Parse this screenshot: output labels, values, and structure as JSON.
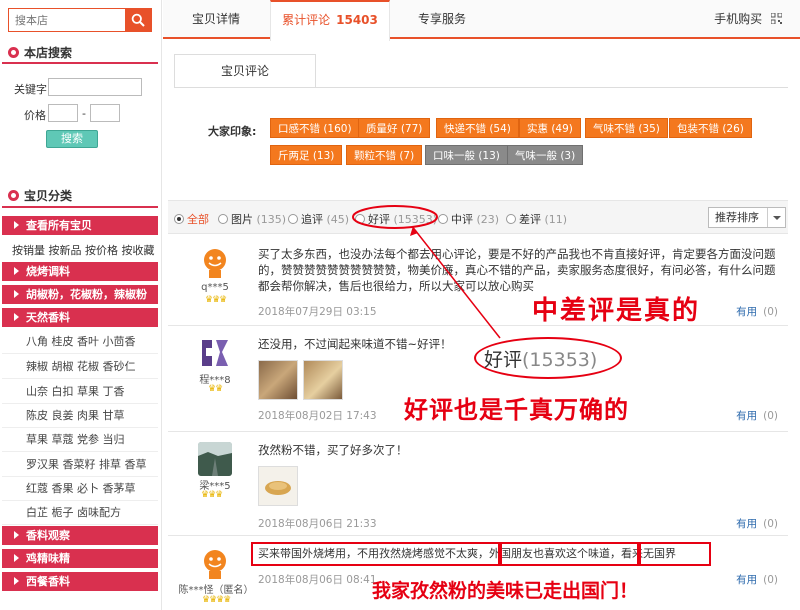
{
  "sidebar": {
    "search_placeholder": "搜本店",
    "store_search": {
      "title": "本店搜索",
      "keyword_label": "关键字",
      "price_label": "价格",
      "price_sep": "-",
      "search_button": "搜索"
    },
    "categories": {
      "title": "宝贝分类",
      "view_all": "查看所有宝贝",
      "sort_links": [
        "按销量",
        "按新品",
        "按价格",
        "按收藏"
      ],
      "bbq": "烧烤调料",
      "pepper": "胡椒粉，花椒粉，辣椒粉",
      "natural": "天然香料",
      "spice_rows": [
        "八角 桂皮 香叶 小茴香",
        "辣椒 胡椒 花椒 香砂仁",
        "山奈 白扣 草果 丁香",
        "陈皮 良姜 肉果 甘草",
        "草果 草蔻 党参 当归",
        "罗汉果 香菜籽 排草 香草",
        "红蔻 香果 必卜 香茅草",
        "白芷 栀子 卤味配方"
      ],
      "spice_cover": "香料观察",
      "chicken": "鸡精味精",
      "western": "西餐香料"
    }
  },
  "tabs": {
    "detail": "宝贝详情",
    "reviews": "累计评论",
    "reviews_count": "15403",
    "service": "专享服务",
    "mobile_buy": "手机购买"
  },
  "review_tab": "宝贝评论",
  "impressions": {
    "label": "大家印象:",
    "tags": [
      {
        "text": "口感不错 (160)",
        "color": "#f4781e"
      },
      {
        "text": "质量好 (77)",
        "color": "#f4781e"
      },
      {
        "text": "快递不错 (54)",
        "color": "#f4781e"
      },
      {
        "text": "实惠 (49)",
        "color": "#f4781e"
      },
      {
        "text": "气味不错 (35)",
        "color": "#f4781e"
      },
      {
        "text": "包装不错 (26)",
        "color": "#f4781e"
      },
      {
        "text": "斤两足 (13)",
        "color": "#f4781e"
      },
      {
        "text": "颗粒不错 (7)",
        "color": "#f4781e"
      },
      {
        "text": "口味一般 (13)",
        "color": "#8a8a8a"
      },
      {
        "text": "气味一般 (3)",
        "color": "#8a8a8a"
      }
    ]
  },
  "filters": {
    "all": "全部",
    "images": "图片",
    "images_count": "(135)",
    "followup": "追评",
    "followup_count": "(45)",
    "good": "好评",
    "good_count": "(15353)",
    "medium": "中评",
    "medium_count": "(23)",
    "bad": "差评",
    "bad_count": "(11)",
    "sort": "推荐排序"
  },
  "reviews": [
    {
      "user": "q***5",
      "text": "买了太多东西，也没办法每个都去用心评论，要是不好的产品我也不肯直接好评，肯定要各方面没问题的，赞赞赞赞赞赞赞赞赞赞，物美价廉，真心不错的产品，卖家服务态度很好，有问必答，有什么问题都会帮你解决，售后也很给力，所以大家可以放心购买",
      "date": "2018年07月29日 03:15",
      "useful": "有用",
      "useful_count": "(0)"
    },
    {
      "user": "程***8",
      "text": "还没用，不过闻起来味道不错~好评！",
      "date": "2018年08月02日 17:43",
      "useful": "有用",
      "useful_count": "(0)"
    },
    {
      "user": "梁***5",
      "text": "孜然粉不错，买了好多次了！",
      "date": "2018年08月06日 21:33",
      "useful": "有用",
      "useful_count": "(0)"
    },
    {
      "user": "陈***怪（匿名）",
      "text_a": "买来带国外烧烤用，不用孜然烧烤感觉不太爽，",
      "text_b": "外国朋友也喜欢这个味道，",
      "text_c": "看来无国界",
      "date": "2018年08月06日 08:41",
      "useful": "有用",
      "useful_count": "(0)"
    }
  ],
  "annotations": {
    "zoom_label": "好评",
    "zoom_count": "(15353)",
    "note1": "中差评是真的",
    "note2": "好评也是千真万确的",
    "note3": "我家孜然粉的美味已走出国门！"
  },
  "colors": {
    "accent": "#e8512a",
    "category_red": "#d9304f",
    "tag_orange": "#f4781e",
    "annotation_red": "#e60012"
  }
}
